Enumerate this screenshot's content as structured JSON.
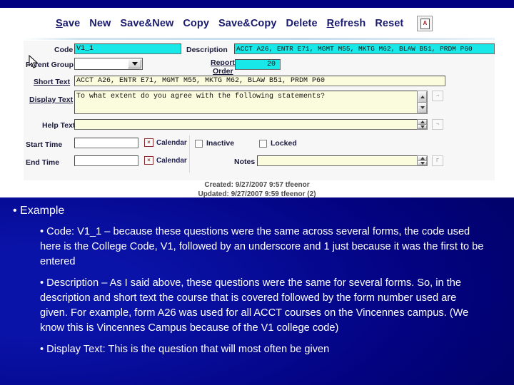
{
  "window": {
    "top_strip_color": "#000080",
    "slide_bg_color": "#03038a"
  },
  "toolbar": {
    "items": [
      {
        "label": "Save",
        "accel": "a",
        "name": "save-button"
      },
      {
        "label": "New",
        "accel": "",
        "name": "new-button"
      },
      {
        "label": "Save&New",
        "accel": "",
        "name": "save-and-new-button"
      },
      {
        "label": "Copy",
        "accel": "",
        "name": "copy-button"
      },
      {
        "label": "Save&Copy",
        "accel": "",
        "name": "save-and-copy-button"
      },
      {
        "label": "Delete",
        "accel": "",
        "name": "delete-button"
      },
      {
        "label": "Refresh",
        "accel": "R",
        "name": "refresh-button"
      },
      {
        "label": "Reset",
        "accel": "",
        "name": "reset-button"
      }
    ],
    "help_button_glyph": "A",
    "link_color": "#1a1a6e"
  },
  "form": {
    "labels": {
      "code": "Code",
      "description": "Description",
      "parent_group": "Parent Group",
      "report_order_line1": "Report",
      "report_order_line2": "Order",
      "short_text": "Short Text",
      "display_text": "Display Text",
      "help_text": "Help Text",
      "start_time": "Start Time",
      "end_time": "End Time",
      "notes": "Notes",
      "inactive": "Inactive",
      "locked": "Locked",
      "calendar": "Calendar"
    },
    "values": {
      "code": "V1_1",
      "description": "ACCT A26, ENTR E71, MGMT M55, MKTG M62, BLAW B51, PRDM P60",
      "parent_group": "",
      "report_order": "20",
      "short_text": "ACCT A26, ENTR E71, MGMT M55, MKTG M62, BLAW  B51, PRDM P60",
      "display_text": "To what extent do you agree with the following statements?",
      "help_text": "",
      "start_time": "",
      "end_time": "",
      "notes": "",
      "inactive_checked": false,
      "locked_checked": false
    },
    "field_colors": {
      "highlighted": "#18e8e8",
      "cream": "#fbfbdd",
      "plain": "#ffffff"
    },
    "audit": {
      "created": "Created:  9/27/2007 9:57 tfeenor",
      "updated": "Updated:  9/27/2007 9:59 tfeenor (2)"
    }
  },
  "slide": {
    "bullet1": "• Example",
    "bullet2": "• Code: V1_1 – because these questions were the same across several forms, the code used here is the College Code, V1, followed by an underscore and 1 just because it was the first to be entered",
    "bullet3": "• Description – As I said above, these questions were the same for several forms. So, in the description and short text the course that is covered followed by the form number used are given. For example, form A26 was used for all ACCT courses on the Vincennes campus. (We know this is Vincennes Campus because of the V1 college code)",
    "bullet4": "• Display Text: This is the question that will most often be given"
  }
}
